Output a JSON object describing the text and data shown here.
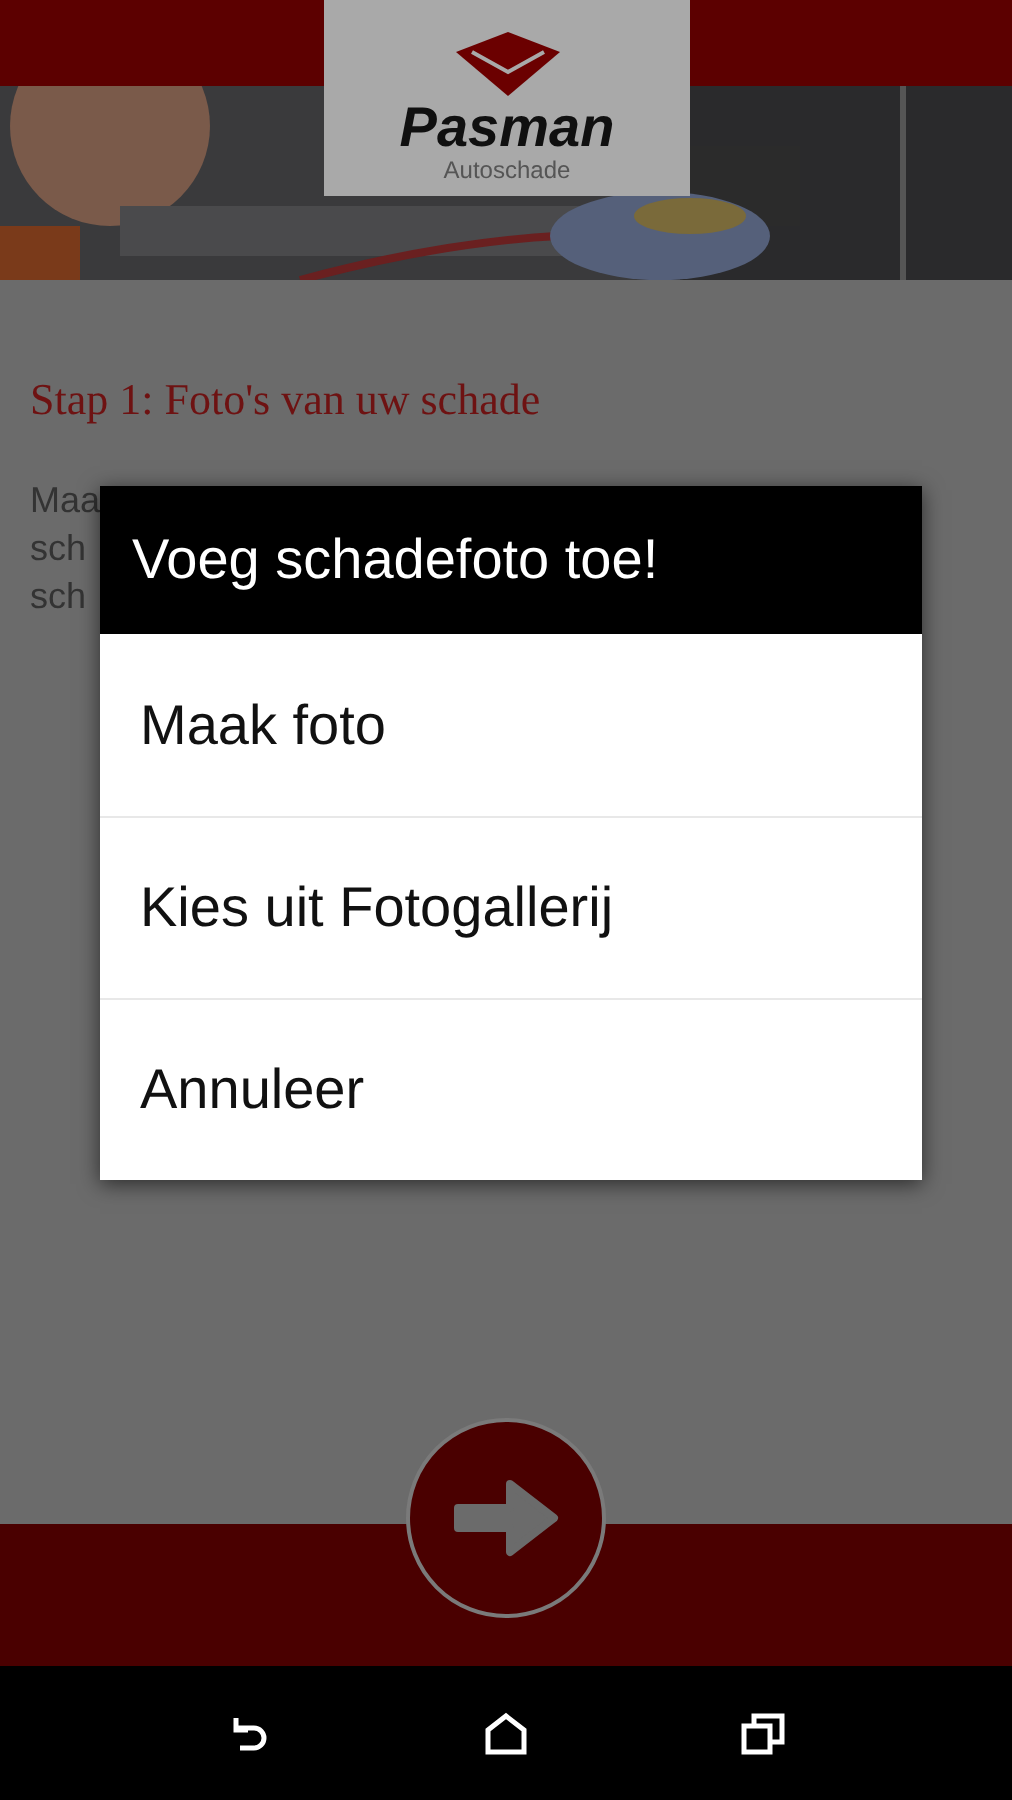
{
  "header": {
    "logo_name": "Pasman",
    "logo_subtitle": "Autoschade"
  },
  "step_title": "Stap 1: Foto's van uw schade",
  "paragraph_fragments": [
    "Maa",
    "sch",
    "sch"
  ],
  "dialog": {
    "title": "Voeg schadefoto toe!",
    "options": [
      {
        "label": "Maak foto"
      },
      {
        "label": "Kies uit Fotogallerij"
      },
      {
        "label": "Annuleer"
      }
    ]
  },
  "nav_bar": {
    "buttons": [
      {
        "kind": "back"
      },
      {
        "kind": "home"
      },
      {
        "kind": "recents"
      }
    ]
  }
}
